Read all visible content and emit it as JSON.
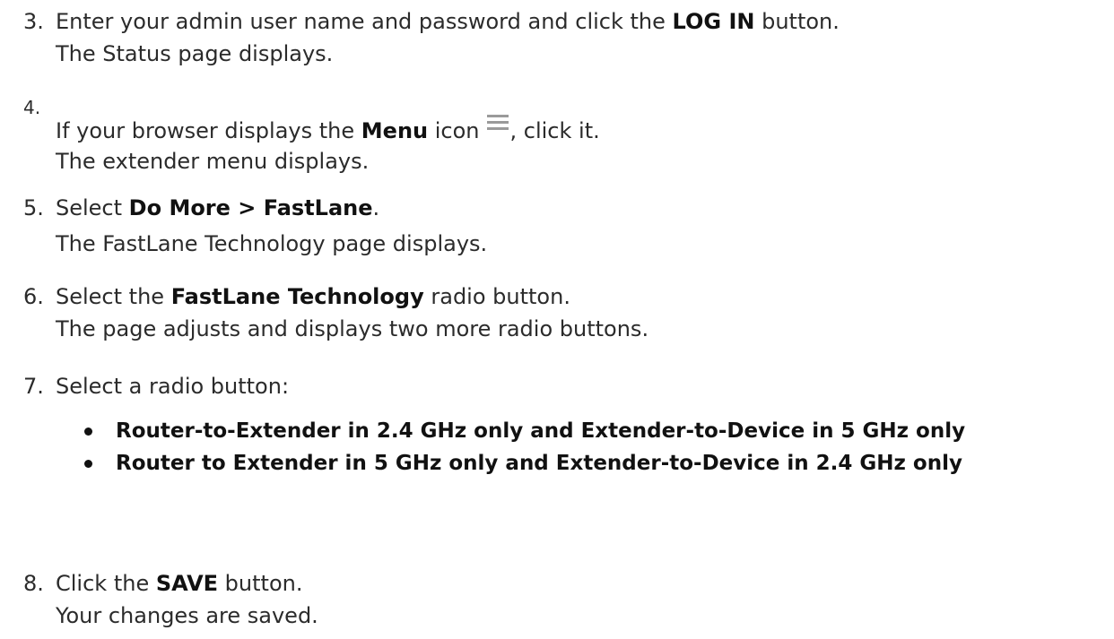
{
  "steps": [
    {
      "number": "3.",
      "before": "Enter your admin user name and password and click the ",
      "bold": "LOG IN",
      "after": " button.",
      "result": "The Status page displays."
    },
    {
      "number": "4.",
      "before": "If your browser displays the ",
      "bold": "Menu",
      "middle": " icon",
      "icon": "menu-hamburger-icon",
      "after": ", click it.",
      "result": "The extender menu displays."
    },
    {
      "number": "5.",
      "before": "Select ",
      "bold": "Do More > FastLane",
      "after": ".",
      "result": "The FastLane Technology page displays."
    },
    {
      "number": "6.",
      "before": "Select the ",
      "bold": "FastLane Technology",
      "after": " radio button.",
      "result": "The page adjusts and displays two more radio buttons."
    },
    {
      "number": "7.",
      "before": "Select a radio button:",
      "options": [
        "Router-to-Extender in 2.4 GHz only and Extender-to-Device in 5 GHz only",
        "Router to Extender in 5 GHz only and Extender-to-Device in 2.4 GHz only"
      ]
    },
    {
      "number": "8.",
      "before": "Click the ",
      "bold": "SAVE",
      "after": " button.",
      "result": "Your changes are saved."
    }
  ],
  "colors": {
    "text": "#2b2b2b",
    "bold_text": "#111111",
    "icon": "#9a9a9a"
  }
}
